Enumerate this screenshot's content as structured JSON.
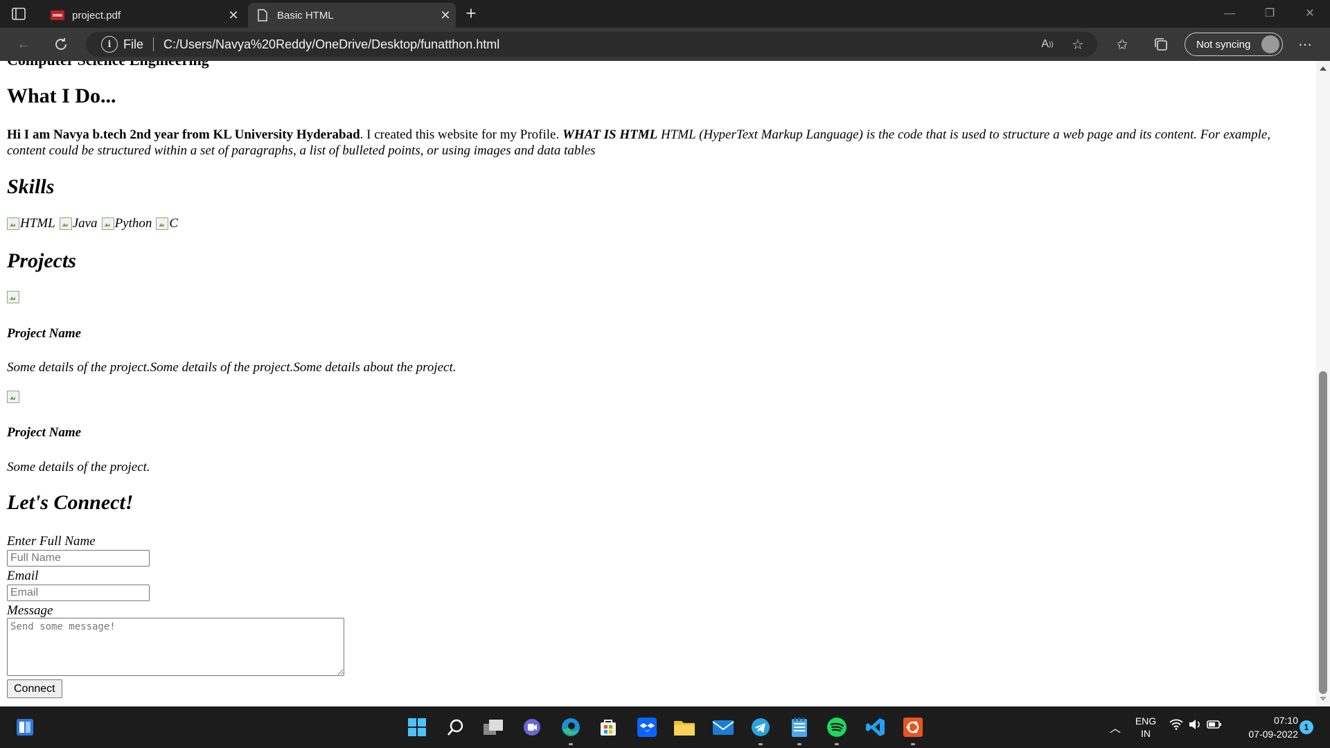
{
  "browser": {
    "tabs": [
      {
        "label": "project.pdf",
        "active": false,
        "icon": "pdf-icon"
      },
      {
        "label": "Basic HTML",
        "active": true,
        "icon": "page-icon"
      }
    ],
    "address": {
      "scheme": "File",
      "url": "C:/Users/Navya%20Reddy/OneDrive/Desktop/funatthon.html"
    },
    "profile_label": "Not syncing"
  },
  "page": {
    "cut_heading": "Computer Science Engineering",
    "what_heading": "What I Do...",
    "intro_bold": "Hi I am Navya b.tech 2nd year from KL University Hyderabad",
    "intro_text": ". I created this website for my Profile. ",
    "intro_bold_italic": "WHAT IS HTML",
    "intro_italic": " HTML (HyperText Markup Language) is the code that is used to structure a web page and its content. For example, content could be structured within a set of paragraphs, a list of bulleted points, or using images and data tables",
    "skills_heading": "Skills",
    "skills": [
      "HTML",
      "Java",
      "Python",
      "C"
    ],
    "projects_heading": "Projects",
    "projects": [
      {
        "name": "Project Name",
        "details": "Some details of the project.Some details of the project.Some details about the project."
      },
      {
        "name": "Project Name",
        "details": "Some details of the project."
      }
    ],
    "connect_heading": "Let's Connect!",
    "form": {
      "name_label": "Enter Full Name",
      "name_placeholder": "Full Name",
      "email_label": "Email",
      "email_placeholder": "Email",
      "message_label": "Message",
      "message_placeholder": "Send some message!",
      "submit_label": "Connect"
    }
  },
  "taskbar": {
    "apps": [
      "start-icon",
      "search-icon",
      "task-view-icon",
      "teams-chat-icon",
      "edge-icon",
      "store-icon",
      "dropbox-icon",
      "file-explorer-icon",
      "mail-icon",
      "telegram-icon",
      "notepad-icon",
      "spotify-icon",
      "vscode-icon",
      "ubuntu-icon"
    ],
    "lang_top": "ENG",
    "lang_bottom": "IN",
    "time": "07:10",
    "date": "07-09-2022",
    "notification_count": "1"
  },
  "colors": {
    "taskbar": "#1c1c1c",
    "toolbar": "#383838",
    "tabstrip": "#202020"
  }
}
